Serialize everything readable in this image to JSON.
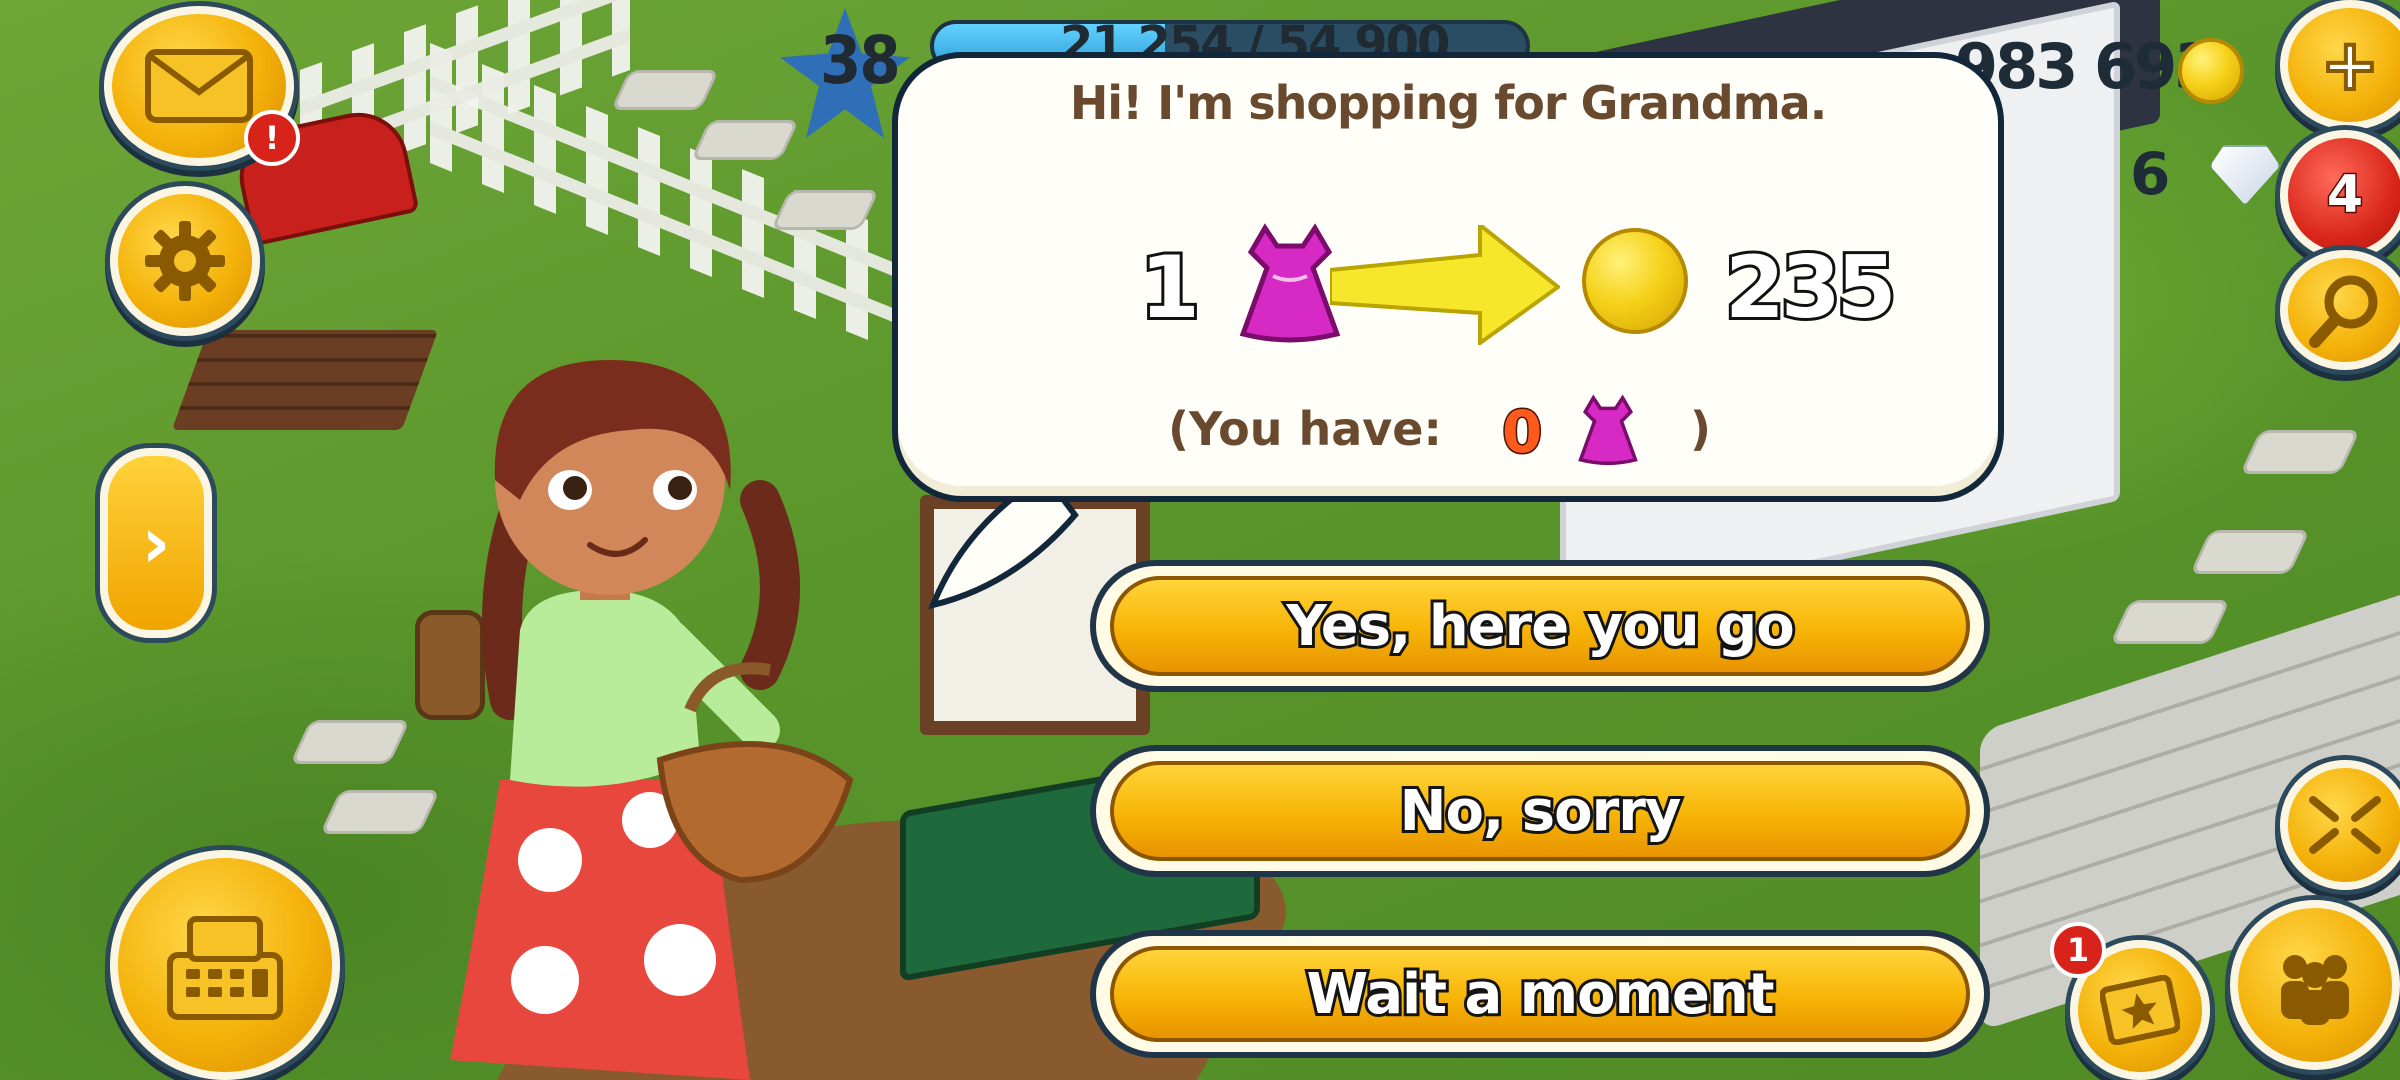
{
  "hud": {
    "level": "38",
    "xp_text": "21 254 / 54 900",
    "xp_progress": 0.39,
    "coins": "983 693",
    "diamonds": "6",
    "mail_alert": "!",
    "friends_badge": "4",
    "newspaper_badge": "1"
  },
  "dialog": {
    "title": "Hi! I'm shopping for Grandma.",
    "item_quantity": "1",
    "item_icon": "pink-dress-icon",
    "reward_amount": "235",
    "reward_icon": "coin-icon",
    "you_have_label": "(You have:",
    "you_have_count": "0",
    "you_have_close": ")"
  },
  "answers": {
    "yes": "Yes, here you go",
    "no": "No, sorry",
    "wait": "Wait a moment"
  },
  "colors": {
    "button_gold": "#f7b406",
    "bubble_text": "#6a4a2e",
    "count_orange": "#ff5a1e"
  }
}
